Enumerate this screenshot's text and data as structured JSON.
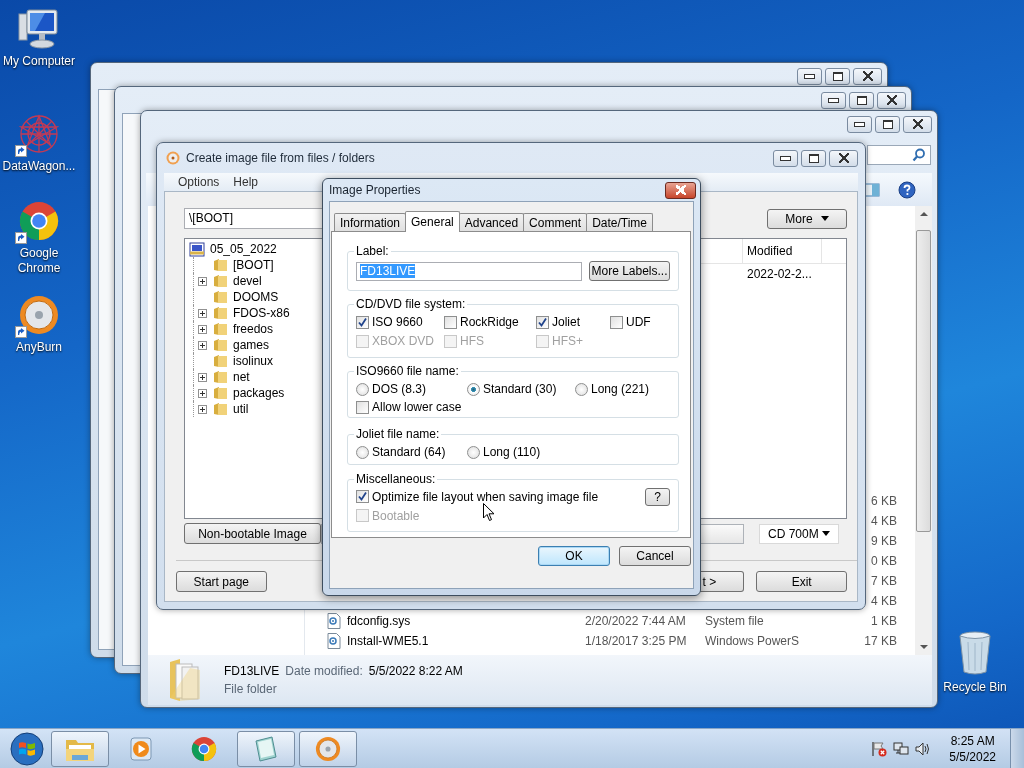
{
  "desktop_icons": [
    {
      "label": "My Computer",
      "kind": "computer",
      "shortcut": false
    },
    {
      "label": "DataWagon...",
      "kind": "web",
      "shortcut": true
    },
    {
      "label": "Google Chrome",
      "kind": "browser",
      "shortcut": true
    },
    {
      "label": "AnyBurn",
      "kind": "disc",
      "shortcut": true
    }
  ],
  "recycle_bin": {
    "label": "Recycle Bin"
  },
  "explorer": {
    "rows": [
      {
        "size": "6 KB"
      },
      {
        "size": "4 KB"
      },
      {
        "size": "9 KB"
      },
      {
        "size": "0 KB"
      },
      {
        "size": "7 KB"
      },
      {
        "size": "4 KB"
      },
      {
        "name": "fdconfig.sys",
        "date": "2/20/2022 7:44 AM",
        "type": "System file",
        "size": "1 KB"
      },
      {
        "name": "Install-WME5.1",
        "date": "1/18/2017 3:25 PM",
        "type": "Windows PowerS",
        "size": "17 KB"
      }
    ],
    "details": {
      "name": "FD13LIVE",
      "date_label": "Date modified:",
      "date": "5/5/2022 8:22 AM",
      "type": "File folder"
    }
  },
  "anyburn": {
    "title": "Create image file from files / folders",
    "menu": [
      "Options",
      "Help"
    ],
    "path": "\\[BOOT]",
    "more_button": "More",
    "tree": {
      "label": "05_05_2022",
      "children": [
        {
          "label": "[BOOT]",
          "expandable": false
        },
        {
          "label": "devel",
          "expandable": true
        },
        {
          "label": "DOOMS",
          "expandable": false
        },
        {
          "label": "FDOS-x86",
          "expandable": true
        },
        {
          "label": "freedos",
          "expandable": true
        },
        {
          "label": "games",
          "expandable": true
        },
        {
          "label": "isolinux",
          "expandable": false
        },
        {
          "label": "net",
          "expandable": true
        },
        {
          "label": "packages",
          "expandable": true
        },
        {
          "label": "util",
          "expandable": true
        }
      ]
    },
    "list_header": "Modified",
    "list_row": "2022-02-2...",
    "boot_button": "Non-bootable Image",
    "media": "CD 700M",
    "buttons": [
      {
        "label": "Start page",
        "kind": "start"
      },
      {
        "label": "t >",
        "kind": "next"
      },
      {
        "label": "Exit",
        "kind": "exit"
      }
    ]
  },
  "dialog": {
    "title": "Image Properties",
    "tabs": [
      {
        "label": "Information",
        "selected": false
      },
      {
        "label": "General",
        "selected": true
      },
      {
        "label": "Advanced",
        "selected": false
      },
      {
        "label": "Comment",
        "selected": false
      },
      {
        "label": "Date/Time",
        "selected": false
      }
    ],
    "label_group": {
      "title": "Label:",
      "value": "FD13LIVE",
      "text_selected": true,
      "button": "More Labels..."
    },
    "filesystem_group": {
      "title": "CD/DVD file system:",
      "options": [
        {
          "label": "ISO 9660",
          "checked": true,
          "disabled": false
        },
        {
          "label": "RockRidge",
          "checked": false,
          "disabled": false
        },
        {
          "label": "Joliet",
          "checked": true,
          "disabled": false
        },
        {
          "label": "UDF",
          "checked": false,
          "disabled": false
        },
        {
          "label": "XBOX DVD",
          "checked": false,
          "disabled": true
        },
        {
          "label": "HFS",
          "checked": false,
          "disabled": true
        },
        {
          "label": "HFS+",
          "checked": false,
          "disabled": true
        }
      ]
    },
    "iso_group": {
      "title": "ISO9660 file name:",
      "options": [
        {
          "label": "DOS (8.3)",
          "selected": false
        },
        {
          "label": "Standard (30)",
          "selected": true
        },
        {
          "label": "Long (221)",
          "selected": false
        }
      ],
      "lowercase": {
        "label": "Allow lower case",
        "checked": false,
        "disabled": false
      }
    },
    "joliet_group": {
      "title": "Joliet file name:",
      "options": [
        {
          "label": "Standard (64)",
          "selected": false
        },
        {
          "label": "Long (110)",
          "selected": false
        }
      ]
    },
    "misc_group": {
      "title": "Miscellaneous:",
      "options": [
        {
          "label": "Optimize file layout when saving image file",
          "checked": true,
          "disabled": false
        },
        {
          "label": "Bootable",
          "checked": false,
          "disabled": true
        }
      ],
      "help_button": "?"
    },
    "buttons": [
      {
        "label": "OK",
        "default": true
      },
      {
        "label": "Cancel",
        "default": false
      }
    ]
  },
  "taskbar": {
    "items": [
      {
        "kind": "folder",
        "active": true
      },
      {
        "kind": "player",
        "active": false
      },
      {
        "kind": "browser",
        "active": false
      },
      {
        "kind": "notepad",
        "active": true
      },
      {
        "kind": "disc",
        "active": true
      }
    ],
    "time": "8:25 AM",
    "date": "5/5/2022"
  }
}
